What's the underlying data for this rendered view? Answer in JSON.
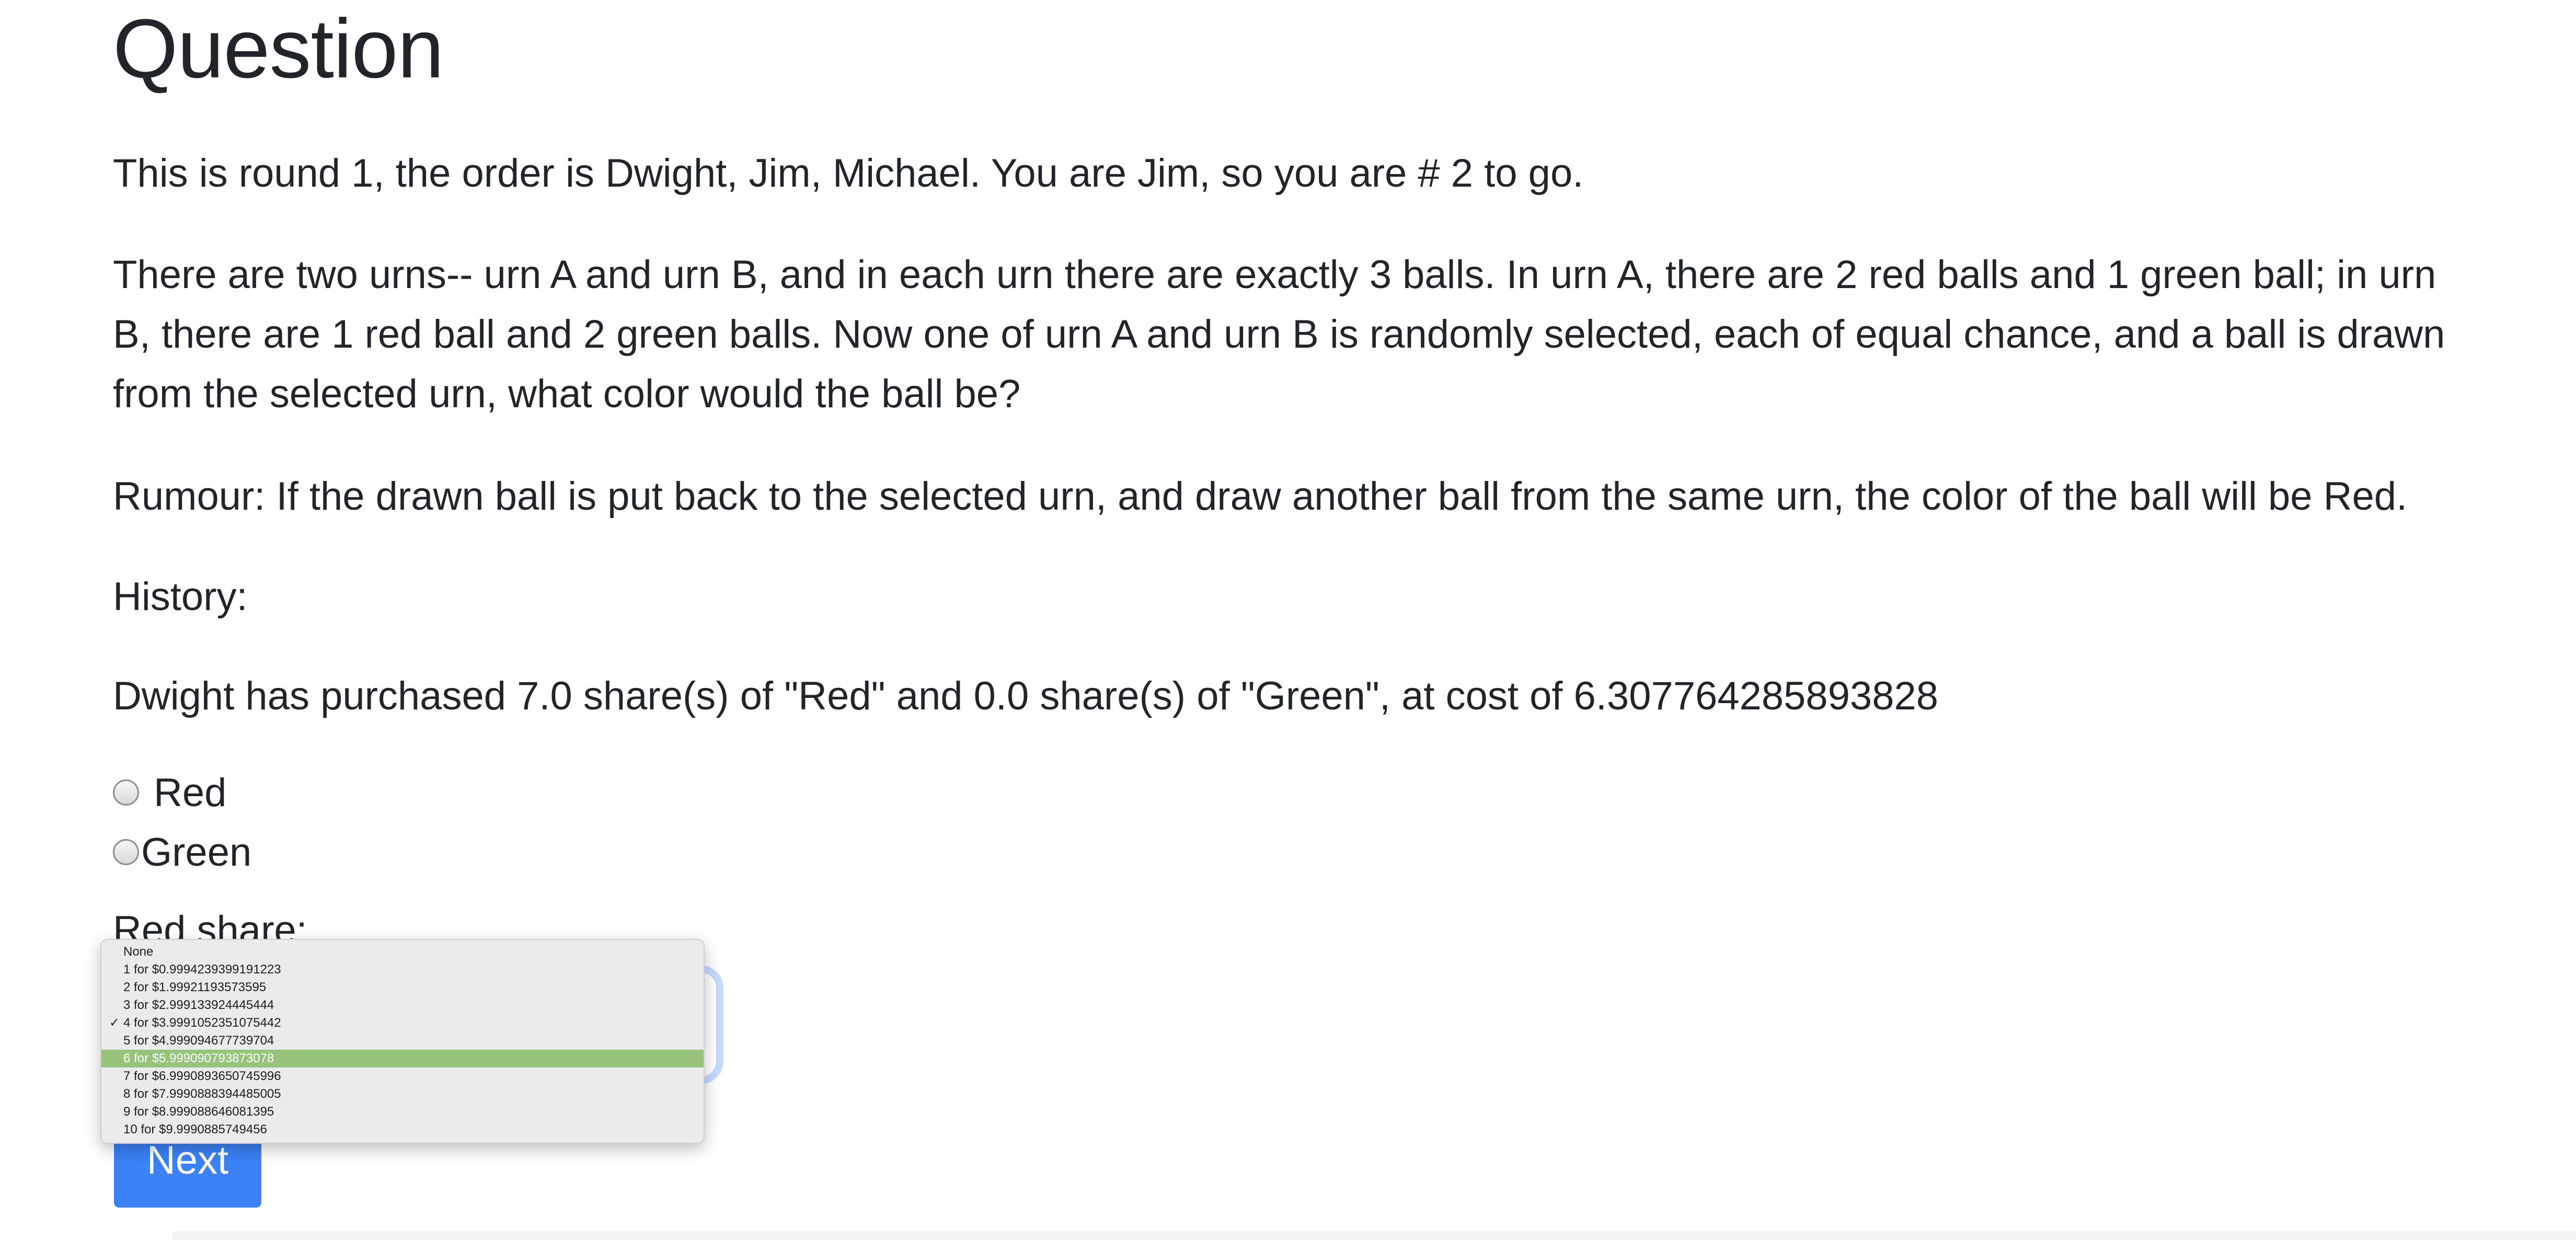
{
  "page": {
    "title": "Question",
    "round_text": "This is round 1, the order is Dwight, Jim, Michael. You are Jim, so you are # 2 to go.",
    "urns_text": "There are two urns-- urn A and urn B, and in each urn there are exactly 3 balls. In urn A, there are 2 red balls and 1 green ball; in urn B, there are 1 red ball and 2 green balls. Now one of urn A and urn B is randomly selected, each of equal chance, and a ball is drawn from the selected urn, what color would the ball be?",
    "rumour_text": "Rumour: If the drawn ball is put back to the selected urn, and draw another ball from the same urn, the color of the ball will be Red.",
    "history_label": "History:",
    "history_entry": "Dwight has purchased 7.0 share(s) of \"Red\" and 0.0 share(s) of \"Green\", at cost of 6.307764285893828"
  },
  "options": {
    "red_label": "Red",
    "green_label": "Green"
  },
  "share": {
    "label": "Red share:",
    "selected_value": "4 for $3.9991052351075442",
    "highlighted_value": "6 for $5.999090793873078",
    "dropdown_options": [
      "None",
      "1 for $0.9994239399191223",
      "2 for $1.99921193573595",
      "3 for $2.999133924445444",
      "4 for $3.9991052351075442",
      "5 for $4.999094677739704",
      "6 for $5.999090793873078",
      "7 for $6.9990893650745996",
      "8 for $7.9990888394485005",
      "9 for $8.999088646081395",
      "10 for $9.9990885749456"
    ],
    "check_mark": "✓"
  },
  "actions": {
    "next_label": "Next"
  },
  "colors": {
    "primary_button": "#3b82f6",
    "highlight": "#97c47a",
    "text": "#212529"
  }
}
